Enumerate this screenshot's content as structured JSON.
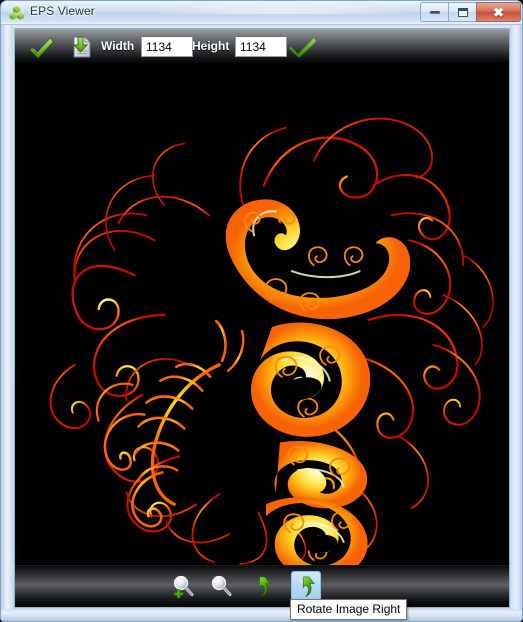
{
  "window": {
    "title": "EPS Viewer",
    "app_icon": "green-cubes-icon",
    "controls": {
      "minimize_label": "—",
      "maximize_label": "□",
      "close_label": "✕"
    }
  },
  "toolbar_top": {
    "open_icon": "open-eps-checkmark-icon",
    "save_icon": "save-document-download-icon",
    "width_label": "Width",
    "width_value": "1134",
    "height_label": "Height",
    "height_value": "1134",
    "apply_icon": "green-checkmark-icon",
    "placeholders": {
      "width": "1134",
      "height": "1134"
    }
  },
  "canvas": {
    "background_color": "#000000",
    "artwork_name": "ornate-swirl-love-calligraphy",
    "artwork_colors": {
      "core": "#fff7c0",
      "inner": "#ffe14a",
      "mid": "#ff9c10",
      "outer": "#f04a05",
      "edge": "#c40d06"
    }
  },
  "toolbar_bottom": {
    "buttons": [
      {
        "name": "zoom-in-button",
        "icon": "magnifier-plus-icon"
      },
      {
        "name": "zoom-out-button",
        "icon": "magnifier-icon"
      },
      {
        "name": "rotate-left-button",
        "icon": "rotate-left-arrow-icon"
      },
      {
        "name": "rotate-right-button",
        "icon": "rotate-right-arrow-icon"
      }
    ]
  },
  "tooltip": {
    "text": "Rotate Image Right",
    "visible": true
  }
}
